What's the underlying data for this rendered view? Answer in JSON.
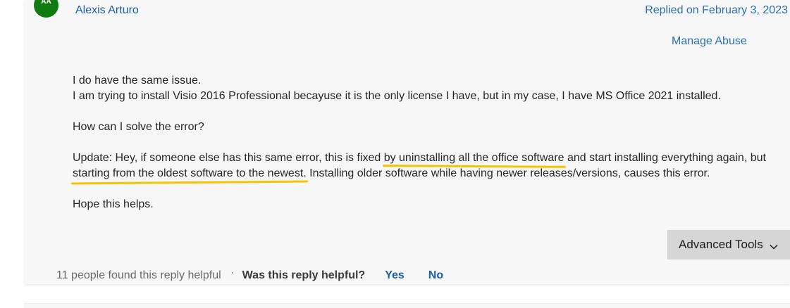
{
  "post": {
    "avatar_initials": "AA",
    "avatar_color": "#107c10",
    "author": "Alexis Arturo",
    "reply_date": "Replied on February 3, 2023",
    "manage_abuse": "Manage Abuse"
  },
  "body": {
    "line1": "I do have the same issue.",
    "line2": "I am trying to install Visio 2016 Professional becayuse it is the only license I have, but in my case, I have MS Office 2021 installed.",
    "line3": "How can I solve the error?",
    "update_part1": "Update: Hey, if someone else has this same error, this is fixed ",
    "update_highlight1": "by uninstalling all the office software",
    "update_part2": " and start installing everything again, but ",
    "update_highlight2": "starting from the oldest software to the newest.",
    "update_part3": " Installing older software while having newer releases/versions, causes this error.",
    "line5": "Hope this helps.",
    "highlight_color": "#f5c400"
  },
  "tools": {
    "advanced_tools_label": "Advanced Tools",
    "chevron_icon": "chevron-down-icon"
  },
  "footer": {
    "helpful_count": "11 people found this reply helpful",
    "separator": "·",
    "question": "Was this reply helpful?",
    "yes": "Yes",
    "no": "No"
  }
}
